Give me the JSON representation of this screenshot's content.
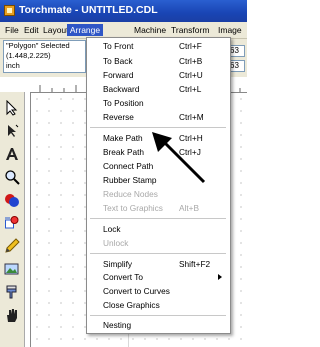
{
  "window": {
    "title": "Torchmate - UNTITLED.CDL"
  },
  "menubar": {
    "items": [
      "File",
      "Edit",
      "Layout",
      "Arrange",
      "Machine",
      "Transform",
      "Image"
    ],
    "active": "Arrange"
  },
  "propbar": {
    "selection_line1": "\"Polygon\" Selected",
    "selection_line2": "(1.448,2.225)",
    "selection_line3": "inch",
    "num1": "63",
    "num2": "63"
  },
  "arrange_menu": {
    "items": [
      {
        "label": "To Front",
        "shortcut": "Ctrl+F",
        "enabled": true
      },
      {
        "label": "To Back",
        "shortcut": "Ctrl+B",
        "enabled": true
      },
      {
        "label": "Forward",
        "shortcut": "Ctrl+U",
        "enabled": true
      },
      {
        "label": "Backward",
        "shortcut": "Ctrl+L",
        "enabled": true
      },
      {
        "label": "To Position",
        "shortcut": "",
        "enabled": true
      },
      {
        "label": "Reverse",
        "shortcut": "Ctrl+M",
        "enabled": true
      },
      {
        "label": "Make Path",
        "shortcut": "Ctrl+H",
        "enabled": true
      },
      {
        "label": "Break Path",
        "shortcut": "Ctrl+J",
        "enabled": true
      },
      {
        "label": "Connect Path",
        "shortcut": "",
        "enabled": true
      },
      {
        "label": "Rubber Stamp",
        "shortcut": "",
        "enabled": true
      },
      {
        "label": "Reduce Nodes",
        "shortcut": "",
        "enabled": false
      },
      {
        "label": "Text to Graphics",
        "shortcut": "Alt+B",
        "enabled": false
      },
      {
        "label": "Lock",
        "shortcut": "",
        "enabled": true
      },
      {
        "label": "Unlock",
        "shortcut": "",
        "enabled": false
      },
      {
        "label": "Simplify",
        "shortcut": "Shift+F2",
        "enabled": true
      },
      {
        "label": "Convert To",
        "shortcut": "",
        "enabled": true
      },
      {
        "label": "Convert to Curves",
        "shortcut": "",
        "enabled": true
      },
      {
        "label": "Close Graphics",
        "shortcut": "",
        "enabled": true
      },
      {
        "label": "Nesting",
        "shortcut": "",
        "enabled": true
      }
    ]
  },
  "toolbox": {
    "tools": [
      "select-arrow-icon",
      "node-edit-icon",
      "text-icon",
      "zoom-icon",
      "color-fill-icon",
      "shape-icon",
      "pencil-icon",
      "image-icon",
      "paint-icon",
      "hand-icon"
    ]
  },
  "colors": {
    "titlebar": "#1945b4",
    "menu_highlight": "#2f56c6",
    "chrome": "#ece9d8",
    "disabled_text": "#a8a8a8"
  }
}
